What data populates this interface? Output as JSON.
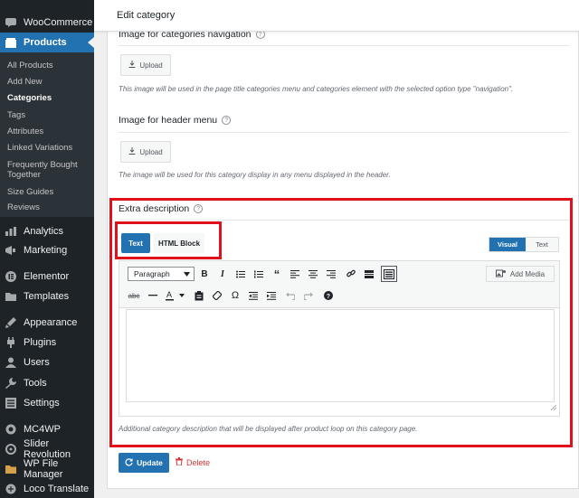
{
  "sidebar": {
    "top_items": [
      {
        "label": "WooCommerce",
        "icon": "woocommerce-icon"
      },
      {
        "label": "Products",
        "icon": "products-icon",
        "active": true
      }
    ],
    "sub_items": [
      {
        "label": "All Products"
      },
      {
        "label": "Add New"
      },
      {
        "label": "Categories",
        "current": true
      },
      {
        "label": "Tags"
      },
      {
        "label": "Attributes"
      },
      {
        "label": "Linked Variations"
      },
      {
        "label": "Frequently Bought Together"
      },
      {
        "label": "Size Guides"
      },
      {
        "label": "Reviews"
      }
    ],
    "items": [
      {
        "label": "Analytics",
        "icon": "analytics-icon"
      },
      {
        "label": "Marketing",
        "icon": "marketing-icon"
      },
      {
        "label": "Elementor",
        "icon": "elementor-icon"
      },
      {
        "label": "Templates",
        "icon": "templates-icon"
      },
      {
        "label": "Appearance",
        "icon": "appearance-icon"
      },
      {
        "label": "Plugins",
        "icon": "plugins-icon"
      },
      {
        "label": "Users",
        "icon": "users-icon"
      },
      {
        "label": "Tools",
        "icon": "tools-icon"
      },
      {
        "label": "Settings",
        "icon": "settings-icon"
      },
      {
        "label": "MC4WP",
        "icon": "mc4wp-icon"
      },
      {
        "label": "Slider Revolution",
        "icon": "slider-revolution-icon"
      },
      {
        "label": "WP File Manager",
        "icon": "file-manager-icon"
      },
      {
        "label": "Loco Translate",
        "icon": "loco-translate-icon"
      }
    ]
  },
  "header": {
    "title": "Edit category"
  },
  "fields": {
    "nav_image": {
      "label": "Image for categories navigation",
      "button": "Upload",
      "note": "This image will be used in the page title categories menu and categories element with the selected option type \"navigation\"."
    },
    "header_image": {
      "label": "Image for header menu",
      "button": "Upload",
      "note": "The image will be used for this category display in any menu displayed in the header."
    },
    "extra_description": {
      "label": "Extra description",
      "tabs": [
        "Text",
        "HTML Block"
      ],
      "mode_visual": "Visual",
      "mode_text": "Text",
      "format_select": "Paragraph",
      "add_media": "Add Media",
      "note": "Additional category description that will be displayed after product loop on this category page."
    }
  },
  "actions": {
    "update": "Update",
    "delete": "Delete"
  },
  "colors": {
    "accent": "#2271b1",
    "highlight": "#e0111b",
    "sidebar": "#1d2327",
    "danger": "#d63638"
  }
}
